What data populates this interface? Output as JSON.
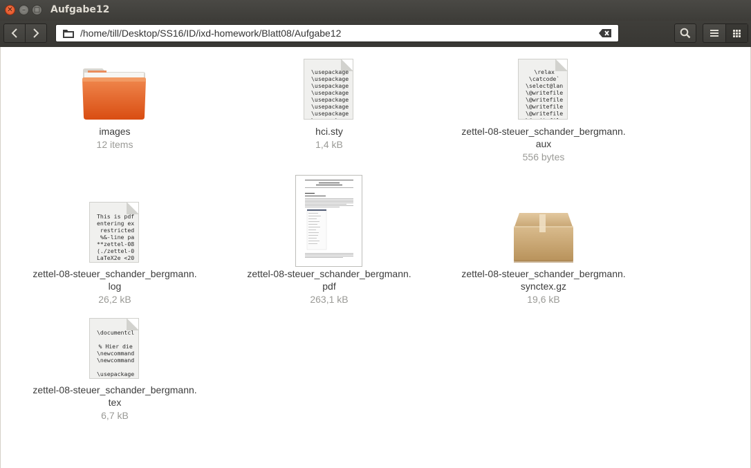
{
  "window": {
    "title": "Aufgabe12"
  },
  "toolbar": {
    "path": "/home/till/Desktop/SS16/ID/ixd-homework/Blatt08/Aufgabe12"
  },
  "files": [
    {
      "name_line1": "images",
      "name_line2": "",
      "meta": "12 items",
      "icon": "folder-icon"
    },
    {
      "name_line1": "hci.sty",
      "name_line2": "",
      "meta": "1,4 kB",
      "icon": "text-file-icon",
      "preview": "\\usepackage\n\\usepackage\n\\usepackage\n\\usepackage\n\\usepackage\n\\usepackage\n\\usepackage\n\\usepackage"
    },
    {
      "name_line1": "zettel-08-steuer_schander_bergmann.",
      "name_line2": "aux",
      "meta": "556 bytes",
      "icon": "text-file-icon",
      "preview": "\\relax\n\\catcode`\n\\select@lan\n\\@writefile\n\\@writefile\n\\@writefile\n\\@writefile\n\\@writefile"
    },
    {
      "name_line1": "zettel-08-steuer_schander_bergmann.",
      "name_line2": "log",
      "meta": "26,2 kB",
      "icon": "text-file-icon",
      "preview": "This is pdf\nentering ex\n restricted\n %&-line pa\n**zettel-08\n(./zettel-0\nLaTeX2e <20"
    },
    {
      "name_line1": "zettel-08-steuer_schander_bergmann.",
      "name_line2": "pdf",
      "meta": "263,1 kB",
      "icon": "pdf-thumbnail-icon"
    },
    {
      "name_line1": "zettel-08-steuer_schander_bergmann.",
      "name_line2": "synctex.gz",
      "meta": "19,6 kB",
      "icon": "archive-box-icon"
    },
    {
      "name_line1": "zettel-08-steuer_schander_bergmann.",
      "name_line2": "tex",
      "meta": "6,7 kB",
      "icon": "text-file-icon",
      "preview": "\\documentcl\n\n% Hier die\n\\newcommand\n\\newcommand\n\n\\usepackage"
    }
  ]
}
